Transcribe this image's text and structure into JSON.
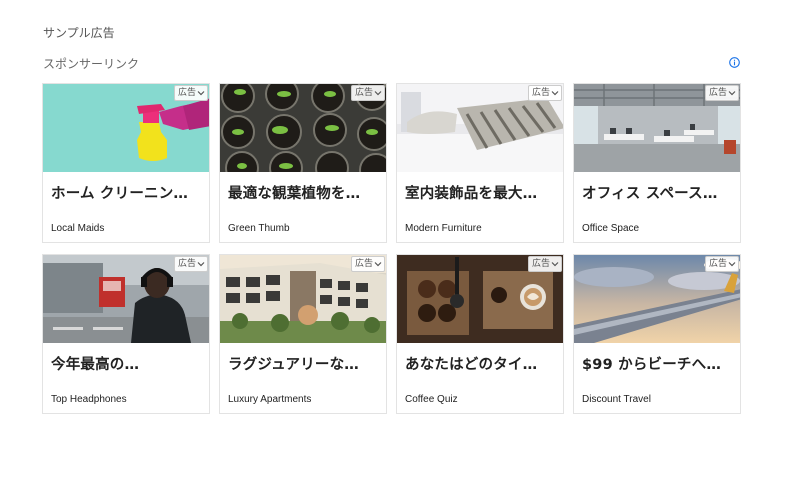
{
  "page": {
    "sample_label": "サンプル広告",
    "section_title": "スポンサーリンク",
    "info_icon": "info-icon",
    "accent_color": "#1a73e8"
  },
  "cards": [
    {
      "headline": "ホーム クリーニン…",
      "brand": "Local Maids",
      "badge": "広告",
      "image": "cleaning-spray-bottle"
    },
    {
      "headline": "最適な観葉植物を…",
      "brand": "Green Thumb",
      "badge": "広告",
      "image": "seedling-pots"
    },
    {
      "headline": "室内装飾品を最大…",
      "brand": "Modern Furniture",
      "badge": "広告",
      "image": "bed-with-pillows"
    },
    {
      "headline": "オフィス スペース…",
      "brand": "Office Space",
      "badge": "広告",
      "image": "open-office"
    },
    {
      "headline": "今年最高の…",
      "brand": "Top Headphones",
      "badge": "広告",
      "image": "man-with-headphones-street"
    },
    {
      "headline": "ラグジュアリーな…",
      "brand": "Luxury Apartments",
      "badge": "広告",
      "image": "apartment-building"
    },
    {
      "headline": "あなたはどのタイ…",
      "brand": "Coffee Quiz",
      "badge": "広告",
      "image": "coffee-beans-latte"
    },
    {
      "headline": "$99 からビーチへ…",
      "brand": "Discount Travel",
      "badge": "広告",
      "image": "airplane-wing-sky"
    }
  ]
}
